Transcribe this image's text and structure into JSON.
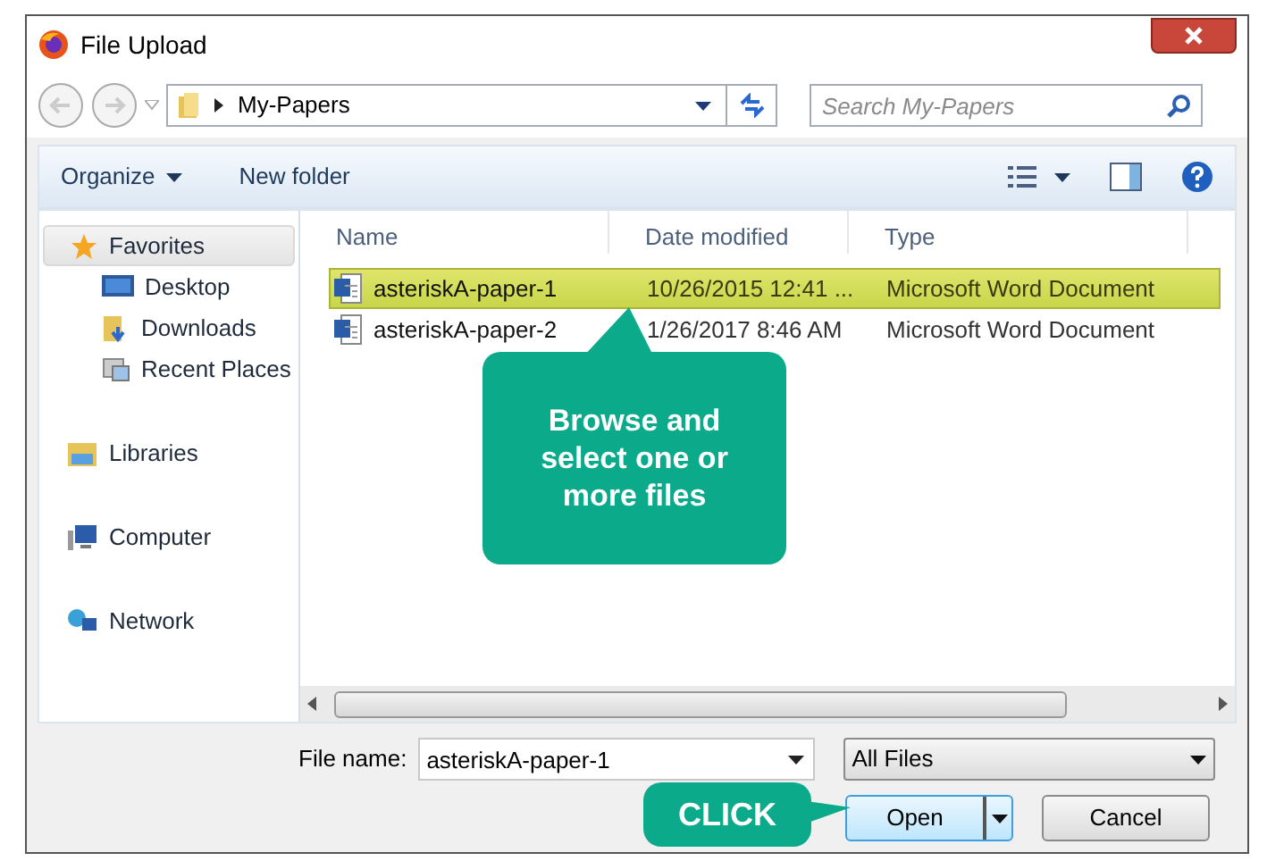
{
  "window": {
    "title": "File Upload"
  },
  "address": {
    "path": "My-Papers"
  },
  "search": {
    "placeholder": "Search My-Papers"
  },
  "toolbar": {
    "organize": "Organize",
    "new_folder": "New folder"
  },
  "sidebar": {
    "items": [
      {
        "kind": "group",
        "label": "Favorites",
        "selected": true
      },
      {
        "kind": "item",
        "label": "Desktop",
        "selected": false
      },
      {
        "kind": "item",
        "label": "Downloads",
        "selected": false
      },
      {
        "kind": "item",
        "label": "Recent Places",
        "selected": false
      },
      {
        "kind": "group",
        "label": "Libraries",
        "selected": false
      },
      {
        "kind": "group",
        "label": "Computer",
        "selected": false
      },
      {
        "kind": "group",
        "label": "Network",
        "selected": false
      }
    ]
  },
  "table": {
    "columns": [
      "Name",
      "Date modified",
      "Type"
    ],
    "rows": [
      {
        "name": "asteriskA-paper-1",
        "date": "10/26/2015 12:41 ...",
        "type": "Microsoft Word Document",
        "selected": true
      },
      {
        "name": "asteriskA-paper-2",
        "date": "1/26/2017 8:46 AM",
        "type": "Microsoft Word Document",
        "selected": false
      }
    ]
  },
  "file_name": {
    "label": "File name:",
    "value": "asteriskA-paper-1"
  },
  "file_type": {
    "value": "All Files"
  },
  "buttons": [
    "Open",
    "Cancel"
  ],
  "callouts": [
    {
      "text": "Browse and select one or more files"
    },
    {
      "text": "CLICK"
    }
  ]
}
